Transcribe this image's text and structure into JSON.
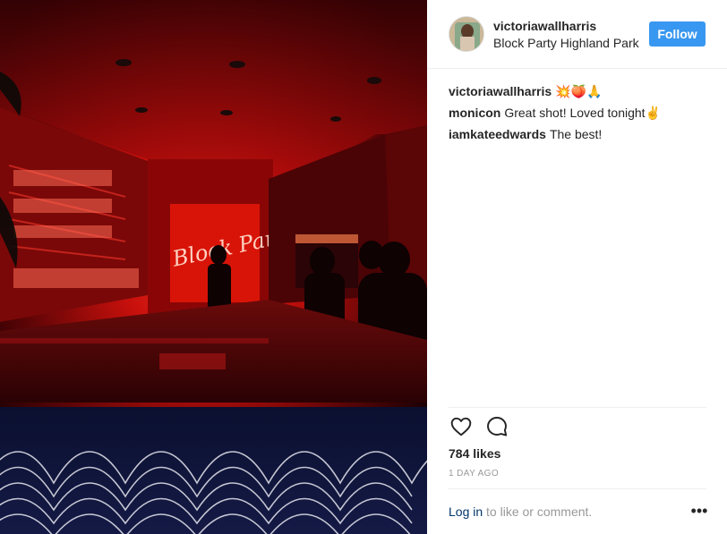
{
  "post": {
    "username": "victoriawallharris",
    "location": "Block Party Highland Park",
    "follow_label": "Follow",
    "caption_emojis": "💥🍑🙏",
    "comments": [
      {
        "user": "monicon",
        "text": "Great shot! Loved tonight✌️"
      },
      {
        "user": "iamkateedwards",
        "text": "The best!"
      }
    ],
    "likes": "784 likes",
    "time_ago": "1 DAY AGO",
    "login_link": "Log in",
    "login_suffix": " to like or comment.",
    "more_label": "•••",
    "neon_sign": "Block Party"
  },
  "icons": {
    "like": "heart-outline-icon",
    "comment": "speech-bubble-icon",
    "more": "more-options-icon"
  },
  "colors": {
    "follow_button": "#3897f0",
    "link": "#003569",
    "muted": "#999999",
    "neon_red": "#ff2a1e"
  }
}
